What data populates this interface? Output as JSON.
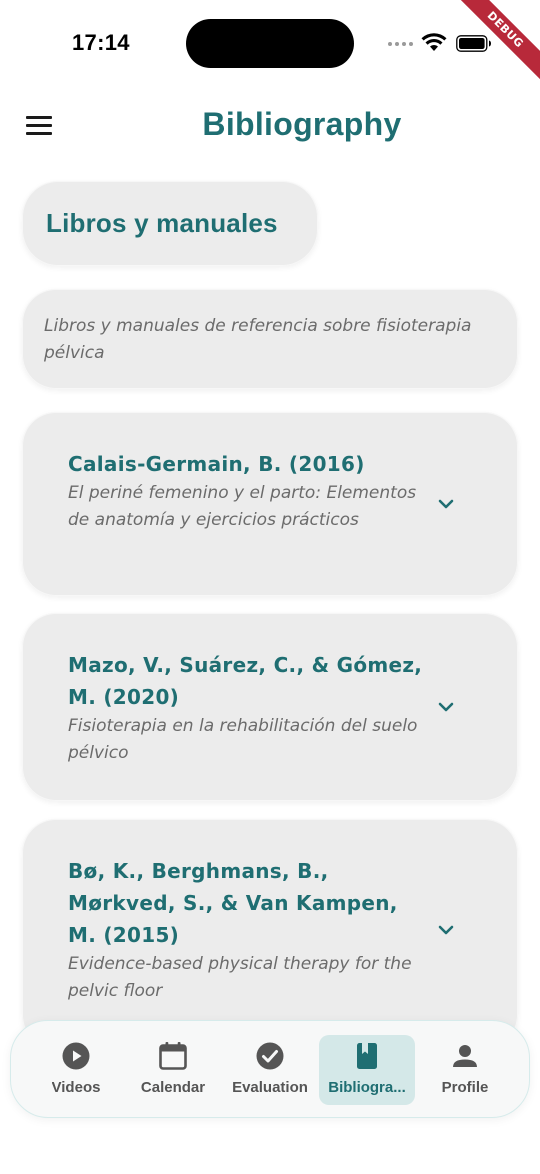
{
  "status_bar": {
    "time": "17:14",
    "debug_label": "DEBUG"
  },
  "header": {
    "title": "Bibliography"
  },
  "section": {
    "title": "Libros y manuales",
    "description": "Libros y manuales de referencia sobre fisioterapia pélvica"
  },
  "entries": [
    {
      "author": "Calais-Germain, B. (2016)",
      "work": "El periné femenino y el parto: Elementos de anatomía y ejercicios prácticos"
    },
    {
      "author": "Mazo, V., Suárez, C., & Gómez, M. (2020)",
      "work": "Fisioterapia en la rehabilitación del suelo pélvico"
    },
    {
      "author": "Bø, K., Berghmans, B., Mørkved, S., & Van Kampen, M. (2015)",
      "work": "Evidence-based physical therapy for the pelvic floor"
    }
  ],
  "bottom_nav": {
    "items": [
      {
        "label": "Videos",
        "icon": "play-circle-icon"
      },
      {
        "label": "Calendar",
        "icon": "calendar-icon"
      },
      {
        "label": "Evaluation",
        "icon": "check-circle-icon"
      },
      {
        "label": "Bibliogra...",
        "icon": "book-icon"
      },
      {
        "label": "Profile",
        "icon": "person-icon"
      }
    ],
    "active_index": 3
  },
  "colors": {
    "accent": "#1f6e72",
    "card": "#ececec",
    "muted_text": "#6b6b6b",
    "active_tab_bg": "#d4e8e8"
  }
}
